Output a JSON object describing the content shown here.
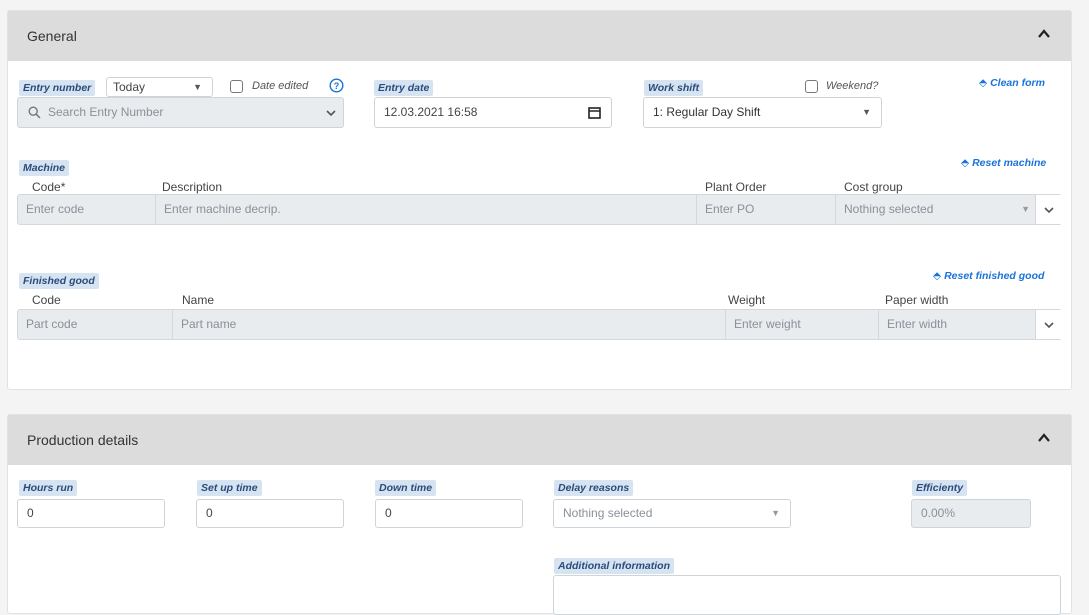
{
  "general": {
    "title": "General",
    "entry_number": {
      "tag": "Entry number",
      "select_value": "Today",
      "date_edited_label": "Date edited",
      "search_placeholder": "Search Entry Number"
    },
    "entry_date": {
      "tag": "Entry date",
      "value": "12.03.2021 16:58"
    },
    "work_shift": {
      "tag": "Work shift",
      "weekend_label": "Weekend?",
      "value": "1: Regular Day Shift"
    },
    "clean_form_label": "Clean form",
    "machine": {
      "tag": "Machine",
      "reset_label": "Reset machine",
      "columns": [
        "Code*",
        "Description",
        "Plant Order",
        "Cost group"
      ],
      "placeholders": [
        "Enter code",
        "Enter machine decrip.",
        "Enter PO",
        "Nothing selected"
      ]
    },
    "finished_good": {
      "tag": "Finished good",
      "reset_label": "Reset finished good",
      "columns": [
        "Code",
        "Name",
        "Weight",
        "Paper width"
      ],
      "placeholders": [
        "Part code",
        "Part name",
        "Enter weight",
        "Enter width"
      ]
    }
  },
  "production": {
    "title": "Production details",
    "hours_run": {
      "tag": "Hours run",
      "value": "0"
    },
    "set_up_time": {
      "tag": "Set up time",
      "value": "0"
    },
    "down_time": {
      "tag": "Down time",
      "value": "0"
    },
    "delay_reasons": {
      "tag": "Delay reasons",
      "value": "Nothing selected"
    },
    "efficiency": {
      "tag": "Efficienty",
      "value": "0.00%"
    },
    "additional_info": {
      "tag": "Additional information"
    }
  }
}
